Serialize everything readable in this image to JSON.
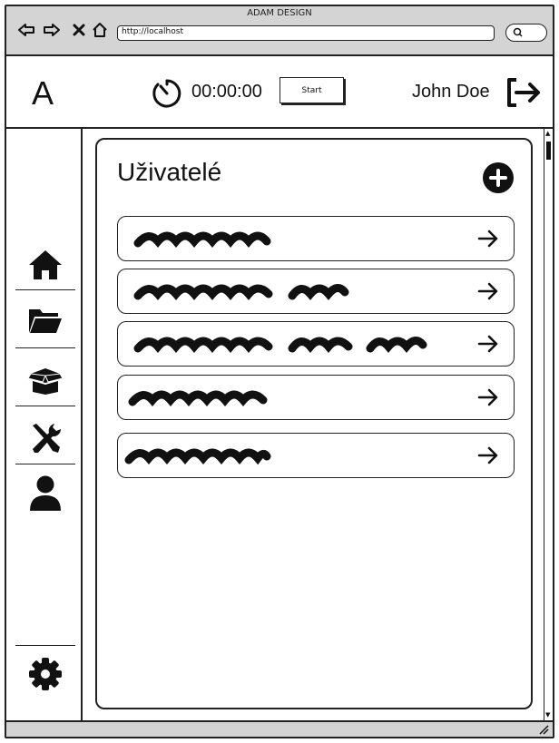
{
  "window": {
    "title": "ADAM DESIGN"
  },
  "browser": {
    "url": "http://localhost"
  },
  "header": {
    "logo": "A",
    "timer": "00:00:00",
    "start_label": "Start",
    "user_name": "John Doe"
  },
  "sidebar": {
    "items": [
      {
        "icon": "home-icon"
      },
      {
        "icon": "folder-icon"
      },
      {
        "icon": "box-icon"
      },
      {
        "icon": "tools-icon"
      },
      {
        "icon": "user-icon"
      },
      {
        "icon": "gear-icon"
      }
    ]
  },
  "main": {
    "title": "Uživatelé",
    "rows": [
      {
        "scribble_segments": 1
      },
      {
        "scribble_segments": 2
      },
      {
        "scribble_segments": 3
      },
      {
        "scribble_segments": 1
      },
      {
        "scribble_segments": 1
      }
    ]
  },
  "colors": {
    "chrome": "#d4d4d4",
    "ink": "#111111"
  }
}
